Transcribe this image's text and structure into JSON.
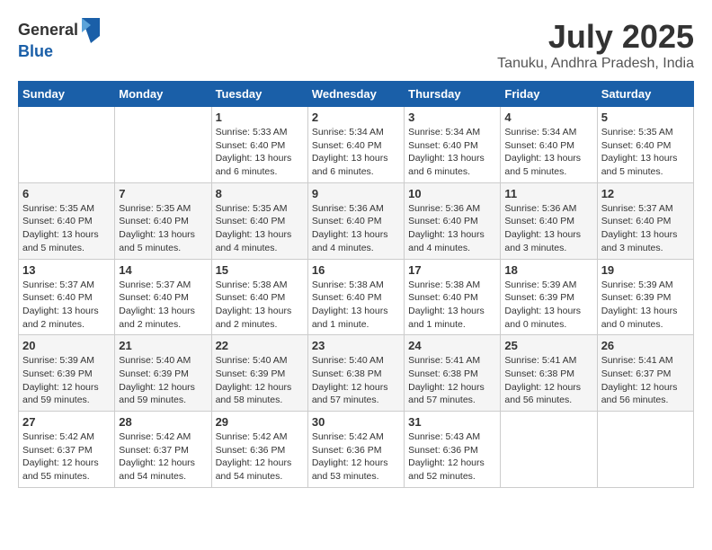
{
  "header": {
    "logo_general": "General",
    "logo_blue": "Blue",
    "month_year": "July 2025",
    "location": "Tanuku, Andhra Pradesh, India"
  },
  "days_of_week": [
    "Sunday",
    "Monday",
    "Tuesday",
    "Wednesday",
    "Thursday",
    "Friday",
    "Saturday"
  ],
  "weeks": [
    [
      {
        "day": "",
        "info": ""
      },
      {
        "day": "",
        "info": ""
      },
      {
        "day": "1",
        "info": "Sunrise: 5:33 AM\nSunset: 6:40 PM\nDaylight: 13 hours and 6 minutes."
      },
      {
        "day": "2",
        "info": "Sunrise: 5:34 AM\nSunset: 6:40 PM\nDaylight: 13 hours and 6 minutes."
      },
      {
        "day": "3",
        "info": "Sunrise: 5:34 AM\nSunset: 6:40 PM\nDaylight: 13 hours and 6 minutes."
      },
      {
        "day": "4",
        "info": "Sunrise: 5:34 AM\nSunset: 6:40 PM\nDaylight: 13 hours and 5 minutes."
      },
      {
        "day": "5",
        "info": "Sunrise: 5:35 AM\nSunset: 6:40 PM\nDaylight: 13 hours and 5 minutes."
      }
    ],
    [
      {
        "day": "6",
        "info": "Sunrise: 5:35 AM\nSunset: 6:40 PM\nDaylight: 13 hours and 5 minutes."
      },
      {
        "day": "7",
        "info": "Sunrise: 5:35 AM\nSunset: 6:40 PM\nDaylight: 13 hours and 5 minutes."
      },
      {
        "day": "8",
        "info": "Sunrise: 5:35 AM\nSunset: 6:40 PM\nDaylight: 13 hours and 4 minutes."
      },
      {
        "day": "9",
        "info": "Sunrise: 5:36 AM\nSunset: 6:40 PM\nDaylight: 13 hours and 4 minutes."
      },
      {
        "day": "10",
        "info": "Sunrise: 5:36 AM\nSunset: 6:40 PM\nDaylight: 13 hours and 4 minutes."
      },
      {
        "day": "11",
        "info": "Sunrise: 5:36 AM\nSunset: 6:40 PM\nDaylight: 13 hours and 3 minutes."
      },
      {
        "day": "12",
        "info": "Sunrise: 5:37 AM\nSunset: 6:40 PM\nDaylight: 13 hours and 3 minutes."
      }
    ],
    [
      {
        "day": "13",
        "info": "Sunrise: 5:37 AM\nSunset: 6:40 PM\nDaylight: 13 hours and 2 minutes."
      },
      {
        "day": "14",
        "info": "Sunrise: 5:37 AM\nSunset: 6:40 PM\nDaylight: 13 hours and 2 minutes."
      },
      {
        "day": "15",
        "info": "Sunrise: 5:38 AM\nSunset: 6:40 PM\nDaylight: 13 hours and 2 minutes."
      },
      {
        "day": "16",
        "info": "Sunrise: 5:38 AM\nSunset: 6:40 PM\nDaylight: 13 hours and 1 minute."
      },
      {
        "day": "17",
        "info": "Sunrise: 5:38 AM\nSunset: 6:40 PM\nDaylight: 13 hours and 1 minute."
      },
      {
        "day": "18",
        "info": "Sunrise: 5:39 AM\nSunset: 6:39 PM\nDaylight: 13 hours and 0 minutes."
      },
      {
        "day": "19",
        "info": "Sunrise: 5:39 AM\nSunset: 6:39 PM\nDaylight: 13 hours and 0 minutes."
      }
    ],
    [
      {
        "day": "20",
        "info": "Sunrise: 5:39 AM\nSunset: 6:39 PM\nDaylight: 12 hours and 59 minutes."
      },
      {
        "day": "21",
        "info": "Sunrise: 5:40 AM\nSunset: 6:39 PM\nDaylight: 12 hours and 59 minutes."
      },
      {
        "day": "22",
        "info": "Sunrise: 5:40 AM\nSunset: 6:39 PM\nDaylight: 12 hours and 58 minutes."
      },
      {
        "day": "23",
        "info": "Sunrise: 5:40 AM\nSunset: 6:38 PM\nDaylight: 12 hours and 57 minutes."
      },
      {
        "day": "24",
        "info": "Sunrise: 5:41 AM\nSunset: 6:38 PM\nDaylight: 12 hours and 57 minutes."
      },
      {
        "day": "25",
        "info": "Sunrise: 5:41 AM\nSunset: 6:38 PM\nDaylight: 12 hours and 56 minutes."
      },
      {
        "day": "26",
        "info": "Sunrise: 5:41 AM\nSunset: 6:37 PM\nDaylight: 12 hours and 56 minutes."
      }
    ],
    [
      {
        "day": "27",
        "info": "Sunrise: 5:42 AM\nSunset: 6:37 PM\nDaylight: 12 hours and 55 minutes."
      },
      {
        "day": "28",
        "info": "Sunrise: 5:42 AM\nSunset: 6:37 PM\nDaylight: 12 hours and 54 minutes."
      },
      {
        "day": "29",
        "info": "Sunrise: 5:42 AM\nSunset: 6:36 PM\nDaylight: 12 hours and 54 minutes."
      },
      {
        "day": "30",
        "info": "Sunrise: 5:42 AM\nSunset: 6:36 PM\nDaylight: 12 hours and 53 minutes."
      },
      {
        "day": "31",
        "info": "Sunrise: 5:43 AM\nSunset: 6:36 PM\nDaylight: 12 hours and 52 minutes."
      },
      {
        "day": "",
        "info": ""
      },
      {
        "day": "",
        "info": ""
      }
    ]
  ]
}
